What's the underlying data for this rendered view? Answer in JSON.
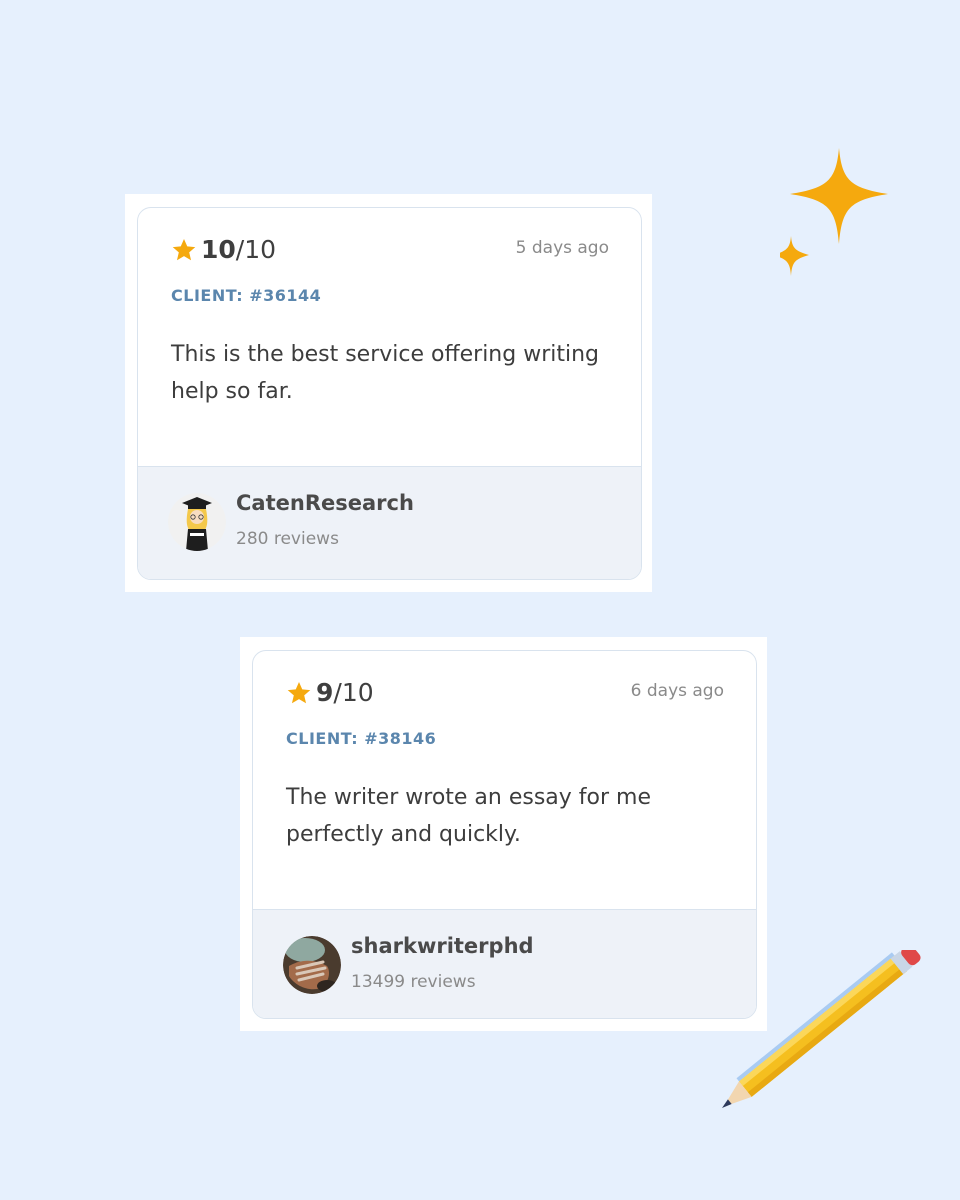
{
  "reviews": [
    {
      "score": "10",
      "scale": "/10",
      "time": "5 days ago",
      "client": "CLIENT: #36144",
      "text": "This is the best service offering writing help so far.",
      "author": "CatenResearch",
      "review_count": "280 reviews"
    },
    {
      "score": "9",
      "scale": "/10",
      "time": "6 days ago",
      "client": "CLIENT: #38146",
      "text": "The writer wrote an essay for me perfectly and quickly.",
      "author": "sharkwriterphd",
      "review_count": "13499 reviews"
    }
  ],
  "colors": {
    "background": "#e6f0fd",
    "star": "#f5a90e",
    "client_label": "#5b86ad",
    "footer": "#eef2f8"
  },
  "icons": {
    "rating": "star-icon",
    "sparkles": "sparkle-icon",
    "pencil": "pencil-icon"
  }
}
